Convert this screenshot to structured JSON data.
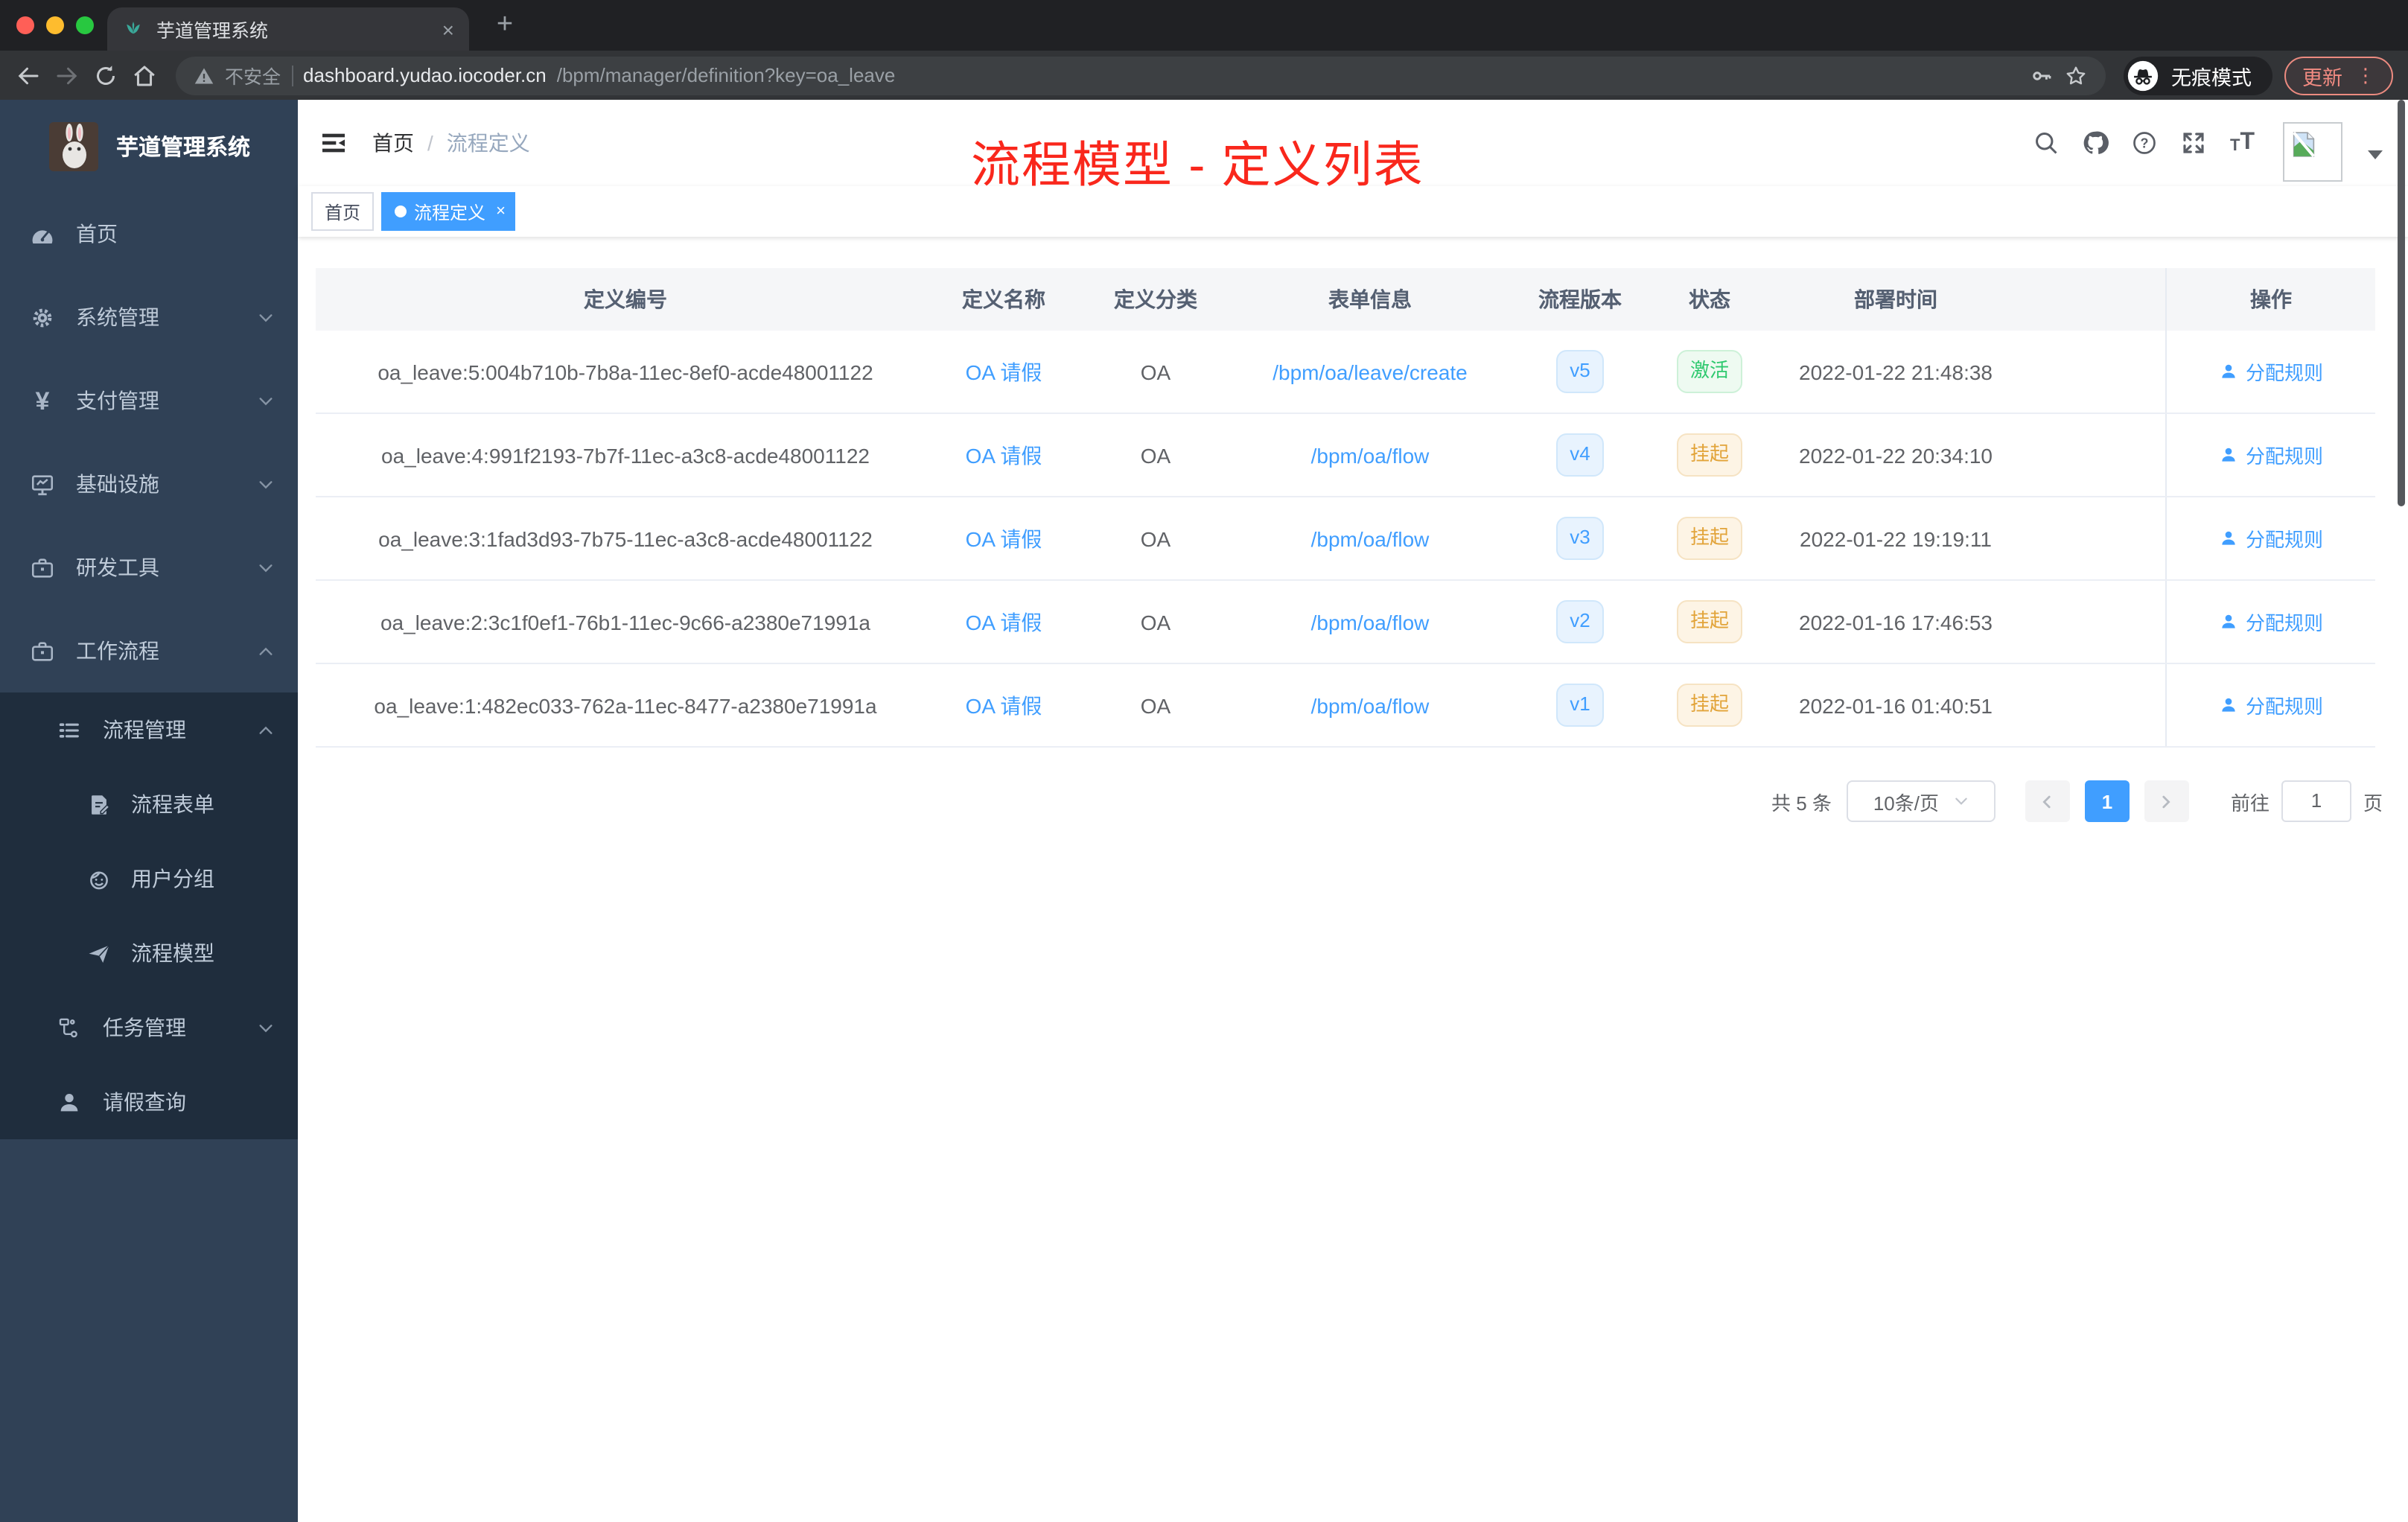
{
  "colors": {
    "accent": "#409eff",
    "annotation_red": "#f9271c",
    "success_green": "#2fc96f",
    "warning_orange": "#e2a43a",
    "sidebar_bg": "#304156",
    "submenu_bg": "#1f2d3d"
  },
  "browser": {
    "tab_title": "芋道管理系统",
    "security_label": "不安全",
    "url_host": "dashboard.yudao.iocoder.cn",
    "url_path": "/bpm/manager/definition?key=oa_leave",
    "incognito_label": "无痕模式",
    "update_label": "更新"
  },
  "icons": {
    "close": "×",
    "plus": "+",
    "dots": "⋮",
    "question": "?",
    "yen": "¥",
    "tt_small": "T",
    "tt_big": "T"
  },
  "sidebar": {
    "app_title": "芋道管理系统",
    "items": [
      {
        "label": "首页"
      },
      {
        "label": "系统管理"
      },
      {
        "label": "支付管理"
      },
      {
        "label": "基础设施"
      },
      {
        "label": "研发工具"
      },
      {
        "label": "工作流程"
      },
      {
        "label": "流程管理"
      },
      {
        "label": "流程表单"
      },
      {
        "label": "用户分组"
      },
      {
        "label": "流程模型"
      },
      {
        "label": "任务管理"
      },
      {
        "label": "请假查询"
      }
    ]
  },
  "header": {
    "breadcrumb_home": "首页",
    "breadcrumb_sep": "/",
    "breadcrumb_current": "流程定义",
    "annotation": "流程模型 - 定义列表"
  },
  "tags": {
    "home": "首页",
    "active": "流程定义"
  },
  "table": {
    "columns": [
      "定义编号",
      "定义名称",
      "定义分类",
      "表单信息",
      "流程版本",
      "状态",
      "部署时间",
      "操作"
    ],
    "rows": [
      {
        "id": "oa_leave:5:004b710b-7b8a-11ec-8ef0-acde48001122",
        "name": "OA 请假",
        "category": "OA",
        "form": "/bpm/oa/leave/create",
        "version": "v5",
        "status": "激活",
        "status_type": "success",
        "time": "2022-01-22 21:48:38",
        "action": "分配规则"
      },
      {
        "id": "oa_leave:4:991f2193-7b7f-11ec-a3c8-acde48001122",
        "name": "OA 请假",
        "category": "OA",
        "form": "/bpm/oa/flow",
        "version": "v4",
        "status": "挂起",
        "status_type": "warning",
        "time": "2022-01-22 20:34:10",
        "action": "分配规则"
      },
      {
        "id": "oa_leave:3:1fad3d93-7b75-11ec-a3c8-acde48001122",
        "name": "OA 请假",
        "category": "OA",
        "form": "/bpm/oa/flow",
        "version": "v3",
        "status": "挂起",
        "status_type": "warning",
        "time": "2022-01-22 19:19:11",
        "action": "分配规则"
      },
      {
        "id": "oa_leave:2:3c1f0ef1-76b1-11ec-9c66-a2380e71991a",
        "name": "OA 请假",
        "category": "OA",
        "form": "/bpm/oa/flow",
        "version": "v2",
        "status": "挂起",
        "status_type": "warning",
        "time": "2022-01-16 17:46:53",
        "action": "分配规则"
      },
      {
        "id": "oa_leave:1:482ec033-762a-11ec-8477-a2380e71991a",
        "name": "OA 请假",
        "category": "OA",
        "form": "/bpm/oa/flow",
        "version": "v1",
        "status": "挂起",
        "status_type": "warning",
        "time": "2022-01-16 01:40:51",
        "action": "分配规则"
      }
    ]
  },
  "pagination": {
    "total": "共 5 条",
    "page_size": "10条/页",
    "page": "1",
    "goto_label": "前往",
    "goto_value": "1",
    "page_unit": "页"
  }
}
